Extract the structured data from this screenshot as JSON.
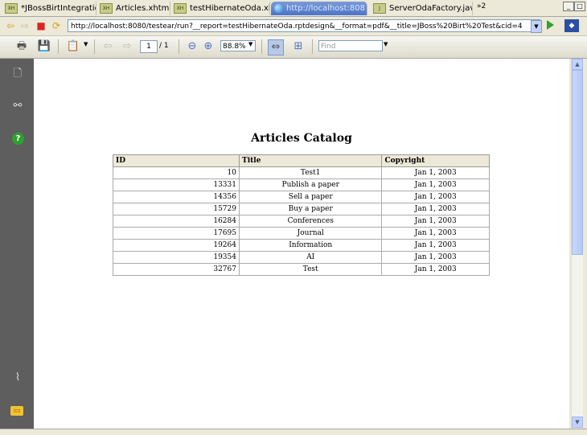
{
  "tabs": [
    {
      "label": "*JBossBirtIntegratio",
      "icon": "xhtml-file-icon",
      "active": false
    },
    {
      "label": "Articles.xhtml",
      "icon": "xhtml-file-icon",
      "active": false
    },
    {
      "label": "testHibernateOda.xht",
      "icon": "xhtml-file-icon",
      "active": false
    },
    {
      "label": "http://localhost:808",
      "icon": "browser-globe-icon",
      "active": true
    },
    {
      "label": "ServerOdaFactory.jav",
      "icon": "java-file-icon",
      "active": false
    }
  ],
  "tab_overflow": "»2",
  "browser": {
    "url": "http://localhost:8080/testear/run?__report=testHibernateOda.rptdesign&__format=pdf&__title=JBoss%20Birt%20Test&cid=4"
  },
  "viewer": {
    "page_current": "1",
    "page_total": "/ 1",
    "zoom": "88.8%",
    "find_placeholder": "Find"
  },
  "report": {
    "title": "Articles Catalog",
    "columns": [
      "ID",
      "Title",
      "Copyright"
    ],
    "rows": [
      {
        "id": "10",
        "title": "Test1",
        "copyright": "Jan 1, 2003"
      },
      {
        "id": "13331",
        "title": "Publish a paper",
        "copyright": "Jan 1, 2003"
      },
      {
        "id": "14356",
        "title": "Sell a paper",
        "copyright": "Jan 1, 2003"
      },
      {
        "id": "15729",
        "title": "Buy a paper",
        "copyright": "Jan 1, 2003"
      },
      {
        "id": "16284",
        "title": "Conferences",
        "copyright": "Jan 1, 2003"
      },
      {
        "id": "17695",
        "title": "Journal",
        "copyright": "Jan 1, 2003"
      },
      {
        "id": "19264",
        "title": "Information",
        "copyright": "Jan 1, 2003"
      },
      {
        "id": "19354",
        "title": "AI",
        "copyright": "Jan 1, 2003"
      },
      {
        "id": "32767",
        "title": "Test",
        "copyright": "Jan 1, 2003"
      }
    ]
  },
  "colors": {
    "accent": "#4b74c9",
    "side_panel": "#5e5e5e",
    "header_bg": "#ece9d8"
  }
}
